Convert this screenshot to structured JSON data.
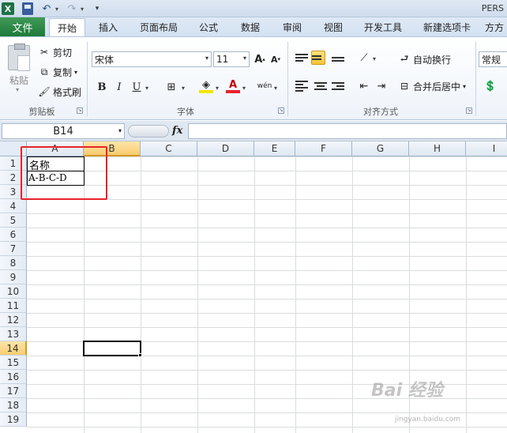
{
  "window": {
    "title": "PERS"
  },
  "tabs": [
    {
      "label": "文件",
      "name": "tab-file"
    },
    {
      "label": "开始",
      "name": "tab-home",
      "active": true
    },
    {
      "label": "插入",
      "name": "tab-insert"
    },
    {
      "label": "页面布局",
      "name": "tab-page-layout"
    },
    {
      "label": "公式",
      "name": "tab-formulas"
    },
    {
      "label": "数据",
      "name": "tab-data"
    },
    {
      "label": "审阅",
      "name": "tab-review"
    },
    {
      "label": "视图",
      "name": "tab-view"
    },
    {
      "label": "开发工具",
      "name": "tab-developer"
    },
    {
      "label": "新建选项卡",
      "name": "tab-new"
    },
    {
      "label": "方方",
      "name": "tab-ffcell"
    }
  ],
  "ribbon": {
    "clipboard": {
      "group_label": "剪贴板",
      "paste": "粘贴",
      "cut": "剪切",
      "copy": "复制",
      "format_painter": "格式刷"
    },
    "font": {
      "group_label": "字体",
      "font_name": "宋体",
      "font_size": "11",
      "bold": "B",
      "italic": "I",
      "underline": "U",
      "font_color_glyph": "A"
    },
    "alignment": {
      "group_label": "对齐方式",
      "wrap_text": "自动换行",
      "merge_center": "合并后居中"
    },
    "number": {
      "format": "常规"
    }
  },
  "formula_bar": {
    "name_box": "B14",
    "fx": "fx",
    "formula": ""
  },
  "sheet": {
    "columns": [
      "A",
      "B",
      "C",
      "D",
      "E",
      "F",
      "G",
      "H",
      "I"
    ],
    "rows": [
      "1",
      "2",
      "3",
      "4",
      "5",
      "6",
      "7",
      "8",
      "9",
      "10",
      "11",
      "12",
      "13",
      "14",
      "15",
      "16",
      "17",
      "18",
      "19"
    ],
    "selected_column": "B",
    "selected_row": "14",
    "cells": {
      "A1": "名称",
      "A2": "A-B-C-D"
    }
  },
  "colors": {
    "file_tab": "#1f7a3c",
    "selection_header": "#f8cc70",
    "annotation_box": "#e8232a"
  },
  "watermark": {
    "text": "Bai 经验",
    "sub": "jingyan.baidu.com"
  }
}
